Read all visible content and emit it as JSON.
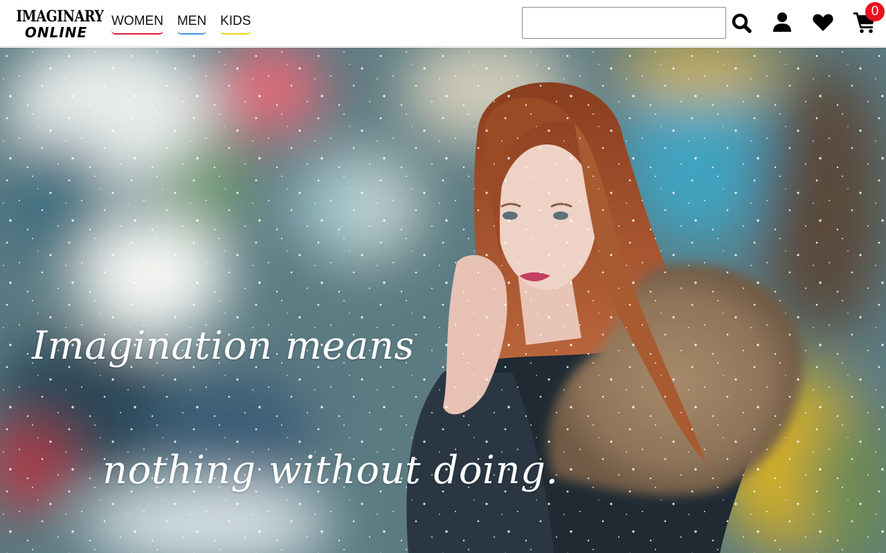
{
  "brand": {
    "line1": "IMAGINARY",
    "line2": "ONLINE"
  },
  "nav": [
    {
      "label": "WOMEN",
      "underline_color": "#d81b36"
    },
    {
      "label": "MEN",
      "underline_color": "#4a90e2"
    },
    {
      "label": "KIDS",
      "underline_color": "#f2d21b"
    }
  ],
  "search": {
    "value": "",
    "placeholder": ""
  },
  "icons": {
    "search": "search-icon",
    "user": "user-icon",
    "wishlist": "heart-icon",
    "cart": "cart-icon"
  },
  "cart": {
    "count": "0",
    "badge_color": "#e8111d"
  },
  "hero": {
    "line1": "Imagination means",
    "line2": "nothing without doing."
  }
}
